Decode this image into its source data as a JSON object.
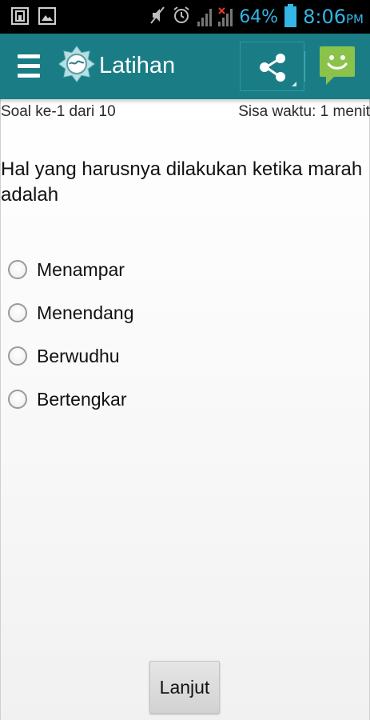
{
  "status_bar": {
    "battery_percent": "64%",
    "time": "8:06",
    "time_suffix": "PM"
  },
  "action_bar": {
    "title": "Latihan",
    "icons": [
      "menu-icon",
      "app-logo-icon",
      "share-icon",
      "chat-icon"
    ]
  },
  "quiz": {
    "counter": "Soal ke-1 dari 10",
    "timer": "Sisa waktu: 1 menit",
    "question": "Hal yang harusnya dilakukan ketika marah adalah",
    "options": [
      {
        "label": "Menampar"
      },
      {
        "label": "Menendang"
      },
      {
        "label": "Berwudhu"
      },
      {
        "label": "Bertengkar"
      }
    ],
    "next_label": "Lanjut"
  },
  "colors": {
    "action_bar": "#1a7d86",
    "status_accent": "#33b5e5",
    "chat_green": "#8bc34a"
  }
}
